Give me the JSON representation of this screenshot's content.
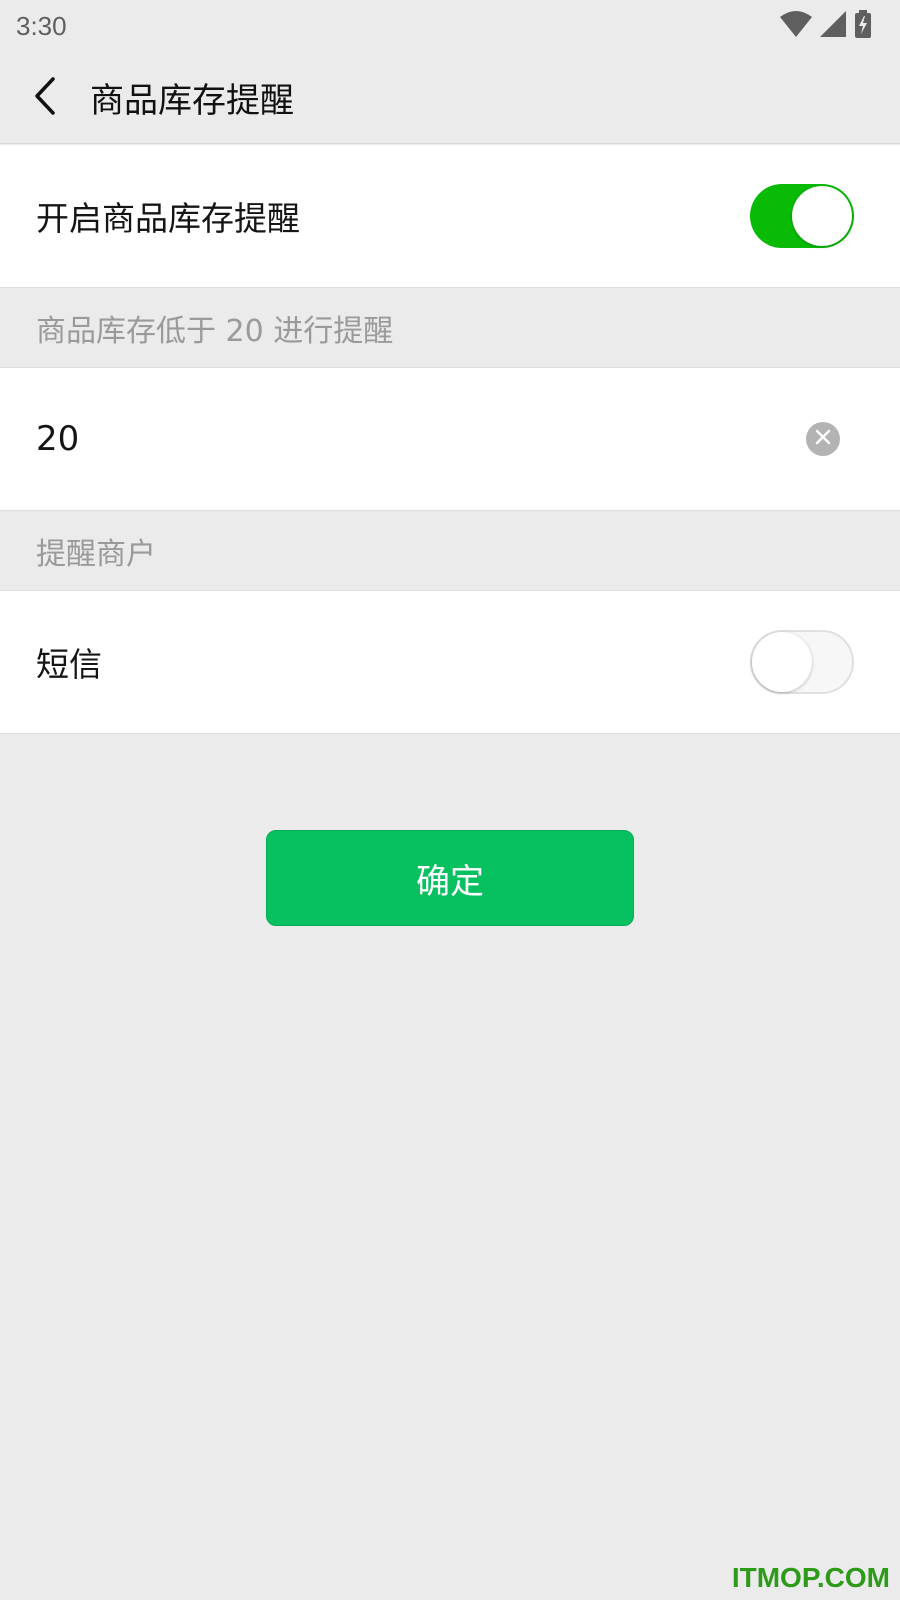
{
  "status_bar": {
    "time": "3:30",
    "icons": [
      "wifi-icon",
      "signal-icon",
      "battery-charging-icon"
    ]
  },
  "nav": {
    "back_icon": "chevron-left-icon",
    "title": "商品库存提醒"
  },
  "stock_alert": {
    "label": "开启商品库存提醒",
    "enabled": true
  },
  "threshold_section": {
    "header": "商品库存低于 20 进行提醒",
    "value": "20",
    "clear_icon": "clear-icon"
  },
  "notify_section": {
    "header": "提醒商户",
    "sms_label": "短信",
    "sms_enabled": false
  },
  "confirm_button": {
    "label": "确定"
  },
  "watermark": "ITMOP.COM",
  "colors": {
    "switch_on": "#09bb07",
    "primary_button": "#07c160",
    "background": "#ebebeb"
  }
}
